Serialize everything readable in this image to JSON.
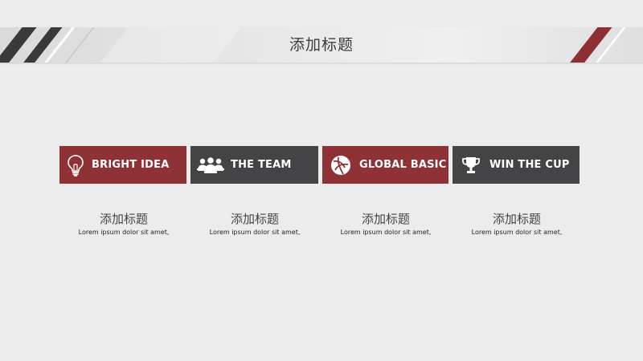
{
  "header": {
    "title": "添加标题"
  },
  "cards": [
    {
      "label": "BRIGHT IDEA",
      "icon": "lightbulb-icon",
      "color": "#8e3236"
    },
    {
      "label": "THE TEAM",
      "icon": "team-icon",
      "color": "#444446"
    },
    {
      "label": "GLOBAL BASIC",
      "icon": "basketball-icon",
      "color": "#8e3236"
    },
    {
      "label": "WIN THE CUP",
      "icon": "trophy-icon",
      "color": "#444446"
    }
  ],
  "captions": [
    {
      "title": "添加标题",
      "text": "Lorem ipsum dolor sit amet,"
    },
    {
      "title": "添加标题",
      "text": "Lorem ipsum dolor sit amet,"
    },
    {
      "title": "添加标题",
      "text": "Lorem ipsum dolor sit amet,"
    },
    {
      "title": "添加标题",
      "text": "Lorem ipsum dolor sit amet,"
    }
  ],
  "colors": {
    "accent_red": "#8e3236",
    "accent_dark": "#444446",
    "background": "#ececec"
  }
}
